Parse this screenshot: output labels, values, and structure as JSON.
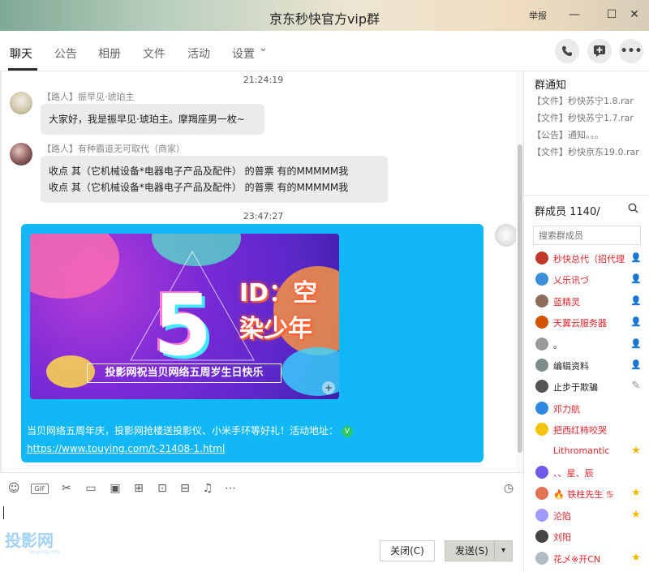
{
  "window": {
    "title": "京东秒快官方vip群",
    "report": "举报",
    "min": "—",
    "max": "☐",
    "close": "✕"
  },
  "tabs": [
    {
      "label": "聊天"
    },
    {
      "label": "公告"
    },
    {
      "label": "相册"
    },
    {
      "label": "文件"
    },
    {
      "label": "活动"
    },
    {
      "label": "设置"
    }
  ],
  "settings_chevron": "⌄",
  "chat": {
    "timestamp1": "21:24:19",
    "msg1": {
      "sender": "【路人】振早见·琥珀主",
      "text": "大家好，我是振早见·琥珀主。摩羯座男一枚~"
    },
    "msg2": {
      "sender": "【路人】有种霸道无可取代（商家）",
      "line1": "收点 其（它机械设备*电器电子产品及配件） 的普票  有的MMMMM我",
      "line2": "收点 其（它机械设备*电器电子产品及配件） 的普票  有的MMMMM我"
    },
    "timestamp2": "23:47:27",
    "promo": {
      "banner_number": "5",
      "banner_caption": "投影网祝当贝网络五周岁生日快乐",
      "watermark_id": "ID：空染少年",
      "text": "当贝网络五周年庆，投影网抢楼送投影仪、小米手环等好礼！活动地址：",
      "badge": "V",
      "link": "https://www.touying.com/t-21408-1.html"
    }
  },
  "input": {
    "close_label": "关闭(C)",
    "send_label": "发送(S)",
    "send_arrow": "▾",
    "logo_text": "投影网",
    "logo_sub": "touying.com"
  },
  "notice": {
    "title": "群通知",
    "items": [
      "【文件】秒快苏宁1.8.rar",
      "【文件】秒快苏宁1.7.rar",
      "【公告】通知。。。",
      "【文件】秒快京东19.0.rar"
    ]
  },
  "members": {
    "title": "群成员 1140/",
    "search_placeholder": "搜索群成员",
    "list": [
      {
        "name": "秒快总代（招代理",
        "color": "#e0262b",
        "badge": "person",
        "badge_color": "#3aa63a"
      },
      {
        "name": "乂乐讯づ",
        "color": "#e0262b",
        "badge": "person",
        "badge_color": "#3aa63a"
      },
      {
        "name": "蓝精灵",
        "color": "#e0262b",
        "badge": "person",
        "badge_color": "#3aa63a"
      },
      {
        "name": "天翼云服务器",
        "color": "#e0262b",
        "badge": "person",
        "badge_color": "#3aa63a"
      },
      {
        "name": "。",
        "color": "#222222",
        "badge": "person",
        "badge_color": "#3aa63a"
      },
      {
        "name": "编辑资料",
        "color": "#222222",
        "badge": "person",
        "badge_color": "#3aa63a"
      },
      {
        "name": "止步于欺骗",
        "color": "#222222",
        "badge": "edit",
        "badge_color": "#888888"
      },
      {
        "name": "邓力航",
        "color": "#e0262b",
        "badge": "",
        "badge_color": ""
      },
      {
        "name": "把西红柿咬哭",
        "color": "#e0262b",
        "badge": "",
        "badge_color": ""
      },
      {
        "name": "Lithromantic",
        "color": "#e0262b",
        "badge": "star",
        "badge_color": "#f5b800"
      },
      {
        "name": "、、星、辰",
        "color": "#e0262b",
        "badge": "",
        "badge_color": ""
      },
      {
        "name": "🔥 铁柱先生 ♋",
        "color": "#e0262b",
        "badge": "star",
        "badge_color": "#f5b800"
      },
      {
        "name": "沦陷",
        "color": "#e0262b",
        "badge": "star",
        "badge_color": "#f5b800"
      },
      {
        "name": "刘阳",
        "color": "#e0262b",
        "badge": "",
        "badge_color": ""
      },
      {
        "name": "花乄※开CN",
        "color": "#e0262b",
        "badge": "star",
        "badge_color": "#f5b800"
      }
    ]
  }
}
